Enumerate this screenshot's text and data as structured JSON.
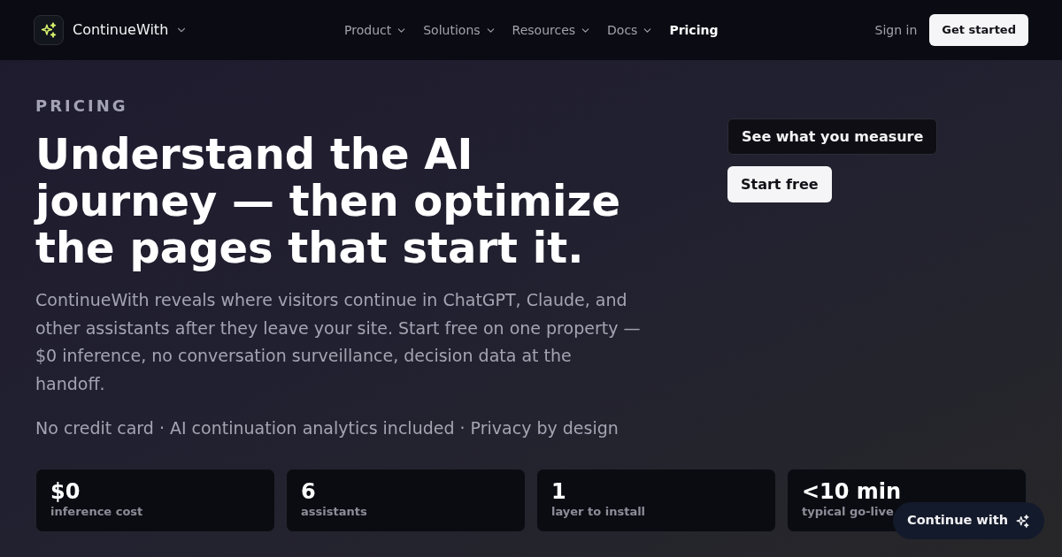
{
  "brand": {
    "name": "ContinueWith",
    "has_menu": true
  },
  "nav": {
    "items": [
      {
        "label": "Product",
        "has_menu": true,
        "selected": false
      },
      {
        "label": "Solutions",
        "has_menu": true,
        "selected": false
      },
      {
        "label": "Resources",
        "has_menu": true,
        "selected": false
      },
      {
        "label": "Docs",
        "has_menu": true,
        "selected": false
      },
      {
        "label": "Pricing",
        "has_menu": false,
        "selected": true
      }
    ]
  },
  "header_actions": {
    "sign_in": "Sign in",
    "get_started": "Get started"
  },
  "hero": {
    "eyebrow": "PRICING",
    "title": "Understand the AI journey — then optimize the pages that start it.",
    "description": "ContinueWith reveals where visitors continue in ChatGPT, Claude, and other assistants after they leave your site. Start free on one property — $0 inference, no conversation surveillance, decision data at the handoff.",
    "highlights": "No credit card · AI continuation analytics included · Privacy by design",
    "buttons": [
      {
        "label": "See what you measure",
        "kind": "secondary"
      },
      {
        "label": "Start free",
        "kind": "primary"
      }
    ]
  },
  "stats": [
    {
      "value": "$0",
      "label": "inference cost"
    },
    {
      "value": "6",
      "label": "assistants"
    },
    {
      "value": "1",
      "label": "layer to install"
    },
    {
      "value": "<10 min",
      "label": "typical go-live"
    }
  ],
  "chat_button": {
    "label": "Continue with"
  }
}
